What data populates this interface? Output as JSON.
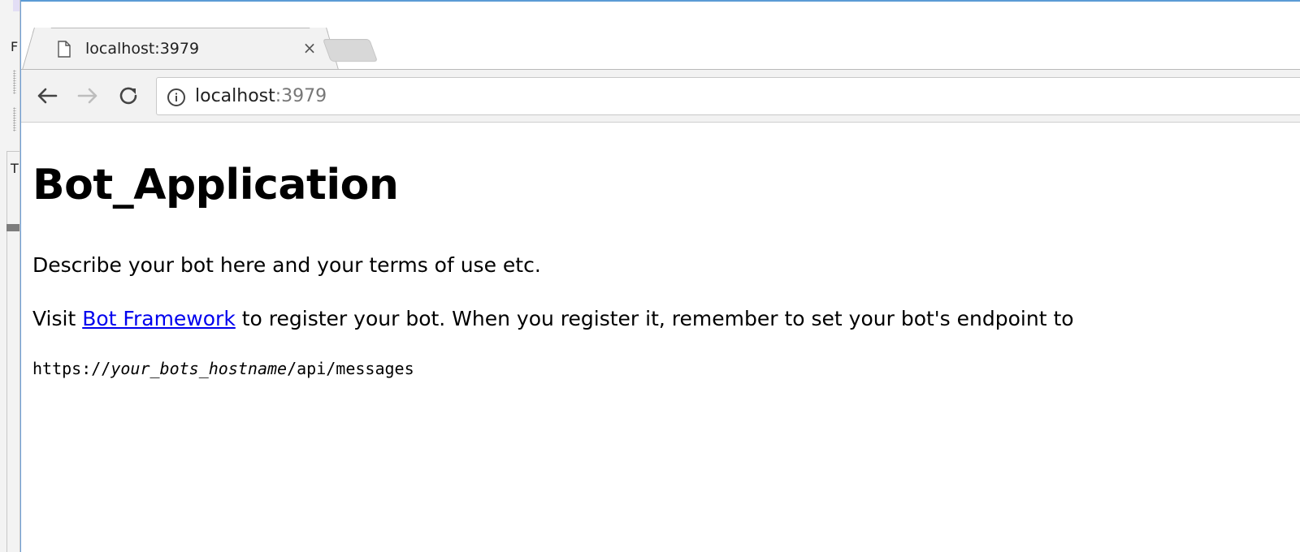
{
  "background_app": {
    "glyphs": [
      "F",
      "T"
    ]
  },
  "browser": {
    "tab": {
      "title": "localhost:3979",
      "close_glyph": "×",
      "icon": "page-icon"
    },
    "toolbar": {
      "back_icon": "back-arrow-icon",
      "forward_icon": "forward-arrow-icon",
      "reload_icon": "reload-icon",
      "address": {
        "host": "localhost",
        "port": ":3979",
        "security_icon": "info-icon"
      }
    }
  },
  "page": {
    "heading": "Bot_Application",
    "description": "Describe your bot here and your terms of use etc.",
    "register": {
      "prefix": "Visit ",
      "link_text": "Bot Framework",
      "suffix": " to register your bot. When you register it, remember to set your bot's endpoint to"
    },
    "endpoint": {
      "scheme": "https://",
      "host_placeholder": "your_bots_hostname",
      "path": "/api/messages"
    }
  },
  "colors": {
    "link": "#0000ee",
    "window_border": "#5b9bd5",
    "chrome_bg": "#f2f2f2"
  }
}
